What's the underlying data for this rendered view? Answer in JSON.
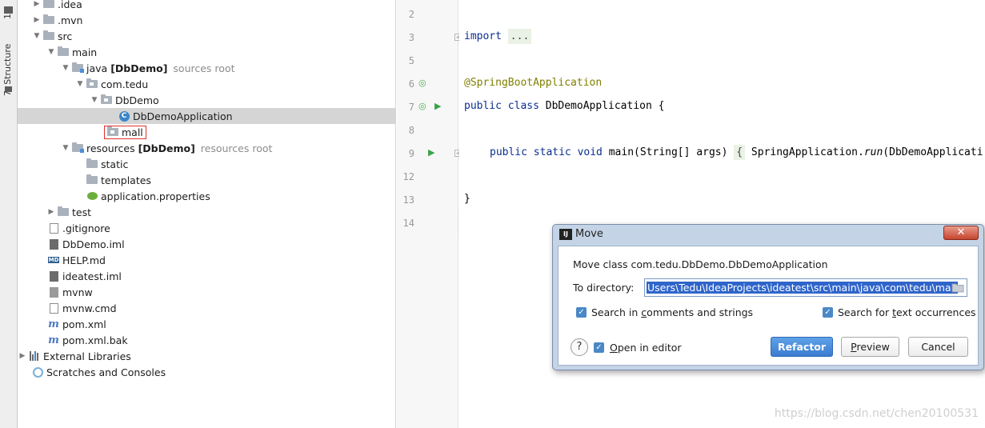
{
  "tool_strip": {
    "tab1": "1",
    "tab2": "7: Structure"
  },
  "tree": {
    "rows": [
      {
        "label": ".idea"
      },
      {
        "label": ".mvn"
      },
      {
        "label": "src"
      },
      {
        "label": "main"
      },
      {
        "label": "java",
        "bold": "[DbDemo]",
        "hint": "sources root"
      },
      {
        "label": "com.tedu"
      },
      {
        "label": "DbDemo"
      },
      {
        "label": "DbDemoApplication",
        "class_icon_letter": "C"
      },
      {
        "label": "mall"
      },
      {
        "label": "resources",
        "bold": "[DbDemo]",
        "hint": "resources root"
      },
      {
        "label": "static"
      },
      {
        "label": "templates"
      },
      {
        "label": "application.properties"
      },
      {
        "label": "test"
      },
      {
        "label": ".gitignore"
      },
      {
        "label": "DbDemo.iml"
      },
      {
        "label": "HELP.md",
        "icon_text": "MD"
      },
      {
        "label": "ideatest.iml"
      },
      {
        "label": "mvnw"
      },
      {
        "label": "mvnw.cmd"
      },
      {
        "label": "pom.xml",
        "icon_text": "m"
      },
      {
        "label": "pom.xml.bak",
        "icon_text": "m"
      },
      {
        "label": "External Libraries"
      },
      {
        "label": "Scratches and Consoles"
      }
    ]
  },
  "editor": {
    "line_numbers": [
      "2",
      "3",
      "5",
      "6",
      "7",
      "8",
      "9",
      "12",
      "13",
      "14"
    ],
    "code": {
      "import_kw": "import",
      "import_folded": "...",
      "annotation": "@SpringBootApplication",
      "class_decl_kw": "public class",
      "class_decl_rest": " DbDemoApplication {",
      "main_kw": "public static void",
      "main_rest": " main(String[] args) ",
      "main_brace": "{",
      "main_body_pre": " SpringApplication.",
      "main_body_it": "run",
      "main_body_post": "(DbDemoApplicati",
      "closing": "}"
    }
  },
  "dialog": {
    "title": "Move",
    "app_icon_text": "IJ",
    "close_glyph": "✕",
    "description": "Move class com.tedu.DbDemo.DbDemoApplication",
    "to_directory_label": "To directory:",
    "to_directory_value": "Users\\Tedu\\IdeaProjects\\ideatest\\src\\main\\java\\com\\tedu\\mall",
    "search_comments_pre": "Search in ",
    "search_comments_u": "c",
    "search_comments_post": "omments and strings",
    "search_text_pre": "Search for ",
    "search_text_u": "t",
    "search_text_post": "ext occurrences",
    "open_in_editor_pre": "",
    "open_in_editor_u": "O",
    "open_in_editor_post": "pen in editor",
    "refactor": "Refactor",
    "preview_u": "P",
    "preview_post": "review",
    "cancel": "Cancel",
    "help_glyph": "?",
    "check_glyph": "✓",
    "checkboxes": {
      "search_comments": true,
      "search_text": true,
      "open_in_editor": true
    }
  },
  "watermark": "https://blog.csdn.net/chen20100531"
}
